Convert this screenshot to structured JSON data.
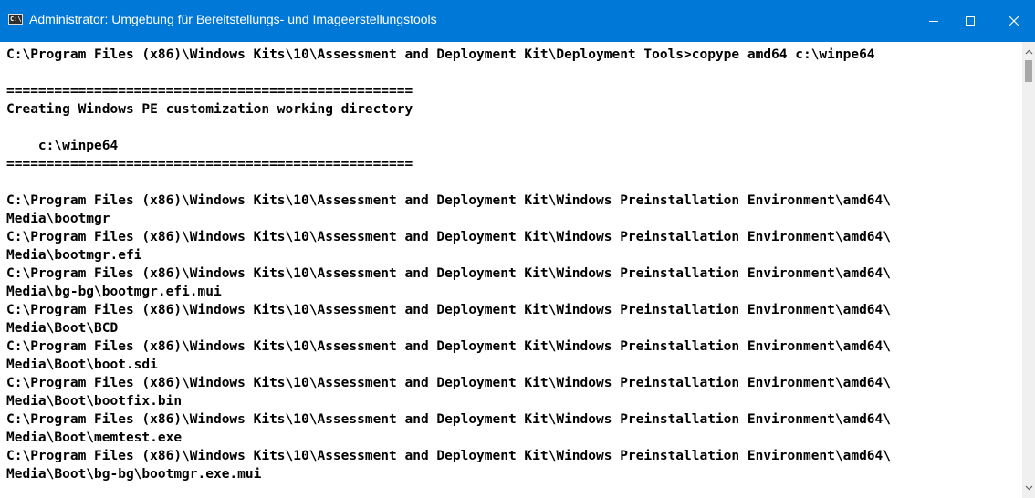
{
  "window": {
    "title": "Administrator: Umgebung für Bereitstellungs- und Imageerstellungstools",
    "app_icon_text": "C:\\",
    "icons": {
      "app": "cmd-icon",
      "minimize": "minimize-icon",
      "maximize": "maximize-icon",
      "close": "close-icon",
      "scroll_up": "chevron-up-icon",
      "scroll_down": "chevron-down-icon"
    },
    "colors": {
      "titlebar": "#0078d7",
      "console_bg": "#ffffff",
      "console_text": "#000000"
    }
  },
  "console": {
    "lines": [
      "C:\\Program Files (x86)\\Windows Kits\\10\\Assessment and Deployment Kit\\Deployment Tools>copype amd64 c:\\winpe64",
      "",
      "===================================================",
      "Creating Windows PE customization working directory",
      "",
      "    c:\\winpe64",
      "===================================================",
      "",
      "C:\\Program Files (x86)\\Windows Kits\\10\\Assessment and Deployment Kit\\Windows Preinstallation Environment\\amd64\\",
      "Media\\bootmgr",
      "C:\\Program Files (x86)\\Windows Kits\\10\\Assessment and Deployment Kit\\Windows Preinstallation Environment\\amd64\\",
      "Media\\bootmgr.efi",
      "C:\\Program Files (x86)\\Windows Kits\\10\\Assessment and Deployment Kit\\Windows Preinstallation Environment\\amd64\\",
      "Media\\bg-bg\\bootmgr.efi.mui",
      "C:\\Program Files (x86)\\Windows Kits\\10\\Assessment and Deployment Kit\\Windows Preinstallation Environment\\amd64\\",
      "Media\\Boot\\BCD",
      "C:\\Program Files (x86)\\Windows Kits\\10\\Assessment and Deployment Kit\\Windows Preinstallation Environment\\amd64\\",
      "Media\\Boot\\boot.sdi",
      "C:\\Program Files (x86)\\Windows Kits\\10\\Assessment and Deployment Kit\\Windows Preinstallation Environment\\amd64\\",
      "Media\\Boot\\bootfix.bin",
      "C:\\Program Files (x86)\\Windows Kits\\10\\Assessment and Deployment Kit\\Windows Preinstallation Environment\\amd64\\",
      "Media\\Boot\\memtest.exe",
      "C:\\Program Files (x86)\\Windows Kits\\10\\Assessment and Deployment Kit\\Windows Preinstallation Environment\\amd64\\",
      "Media\\Boot\\bg-bg\\bootmgr.exe.mui"
    ]
  }
}
